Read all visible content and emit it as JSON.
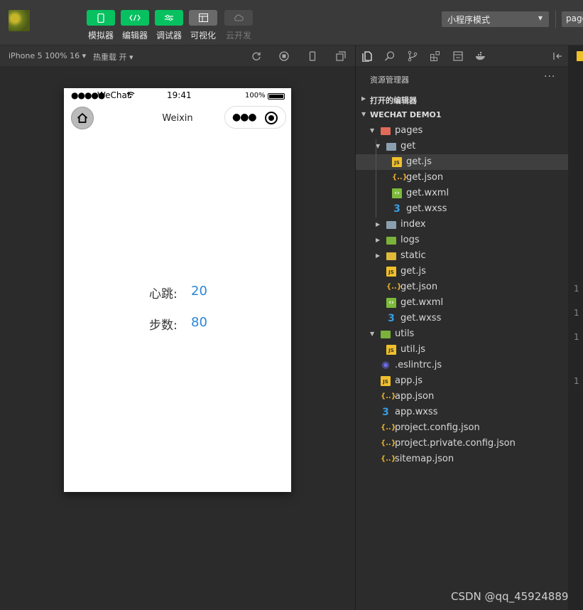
{
  "toolbar": {
    "tools": [
      {
        "label": "模拟器",
        "icon": "phone-icon"
      },
      {
        "label": "编辑器",
        "icon": "code-icon"
      },
      {
        "label": "调试器",
        "icon": "debug-icon"
      },
      {
        "label": "可视化",
        "icon": "layout-icon"
      },
      {
        "label": "云开发",
        "icon": "cloud-icon"
      }
    ],
    "mode": "小程序模式",
    "page_select": "page"
  },
  "simulator_bar": {
    "device": "iPhone 5 100% 16",
    "hot_reload": "热重载 开"
  },
  "phone": {
    "status": {
      "signal": "●●●●●",
      "carrier": "WeChat",
      "time": "19:41",
      "battery": "100%"
    },
    "nav_title": "Weixin",
    "rows": [
      {
        "label": "心跳:",
        "value": "20"
      },
      {
        "label": "步数:",
        "value": "80"
      }
    ]
  },
  "explorer": {
    "title": "资源管理器",
    "more": "···",
    "open_editors": "打开的编辑器",
    "project": "WECHAT DEMO1",
    "items": [
      {
        "name": "pages",
        "type": "folder-red",
        "indent": 0,
        "arrow": "▾"
      },
      {
        "name": "get",
        "type": "folder",
        "indent": 1,
        "arrow": "▾"
      },
      {
        "name": "get.js",
        "type": "js",
        "indent": 2,
        "selected": true
      },
      {
        "name": "get.json",
        "type": "json",
        "indent": 2
      },
      {
        "name": "get.wxml",
        "type": "wxml",
        "indent": 2
      },
      {
        "name": "get.wxss",
        "type": "wxss",
        "indent": 2
      },
      {
        "name": "index",
        "type": "folder",
        "indent": 1,
        "arrow": "▸"
      },
      {
        "name": "logs",
        "type": "folder-green",
        "indent": 1,
        "arrow": "▸"
      },
      {
        "name": "static",
        "type": "folder-yellow",
        "indent": 1,
        "arrow": "▸"
      },
      {
        "name": "get.js",
        "type": "js",
        "indent": 1
      },
      {
        "name": "get.json",
        "type": "json",
        "indent": 1
      },
      {
        "name": "get.wxml",
        "type": "wxml",
        "indent": 1
      },
      {
        "name": "get.wxss",
        "type": "wxss",
        "indent": 1
      },
      {
        "name": "utils",
        "type": "folder-green",
        "indent": 0,
        "arrow": "▾"
      },
      {
        "name": "util.js",
        "type": "js",
        "indent": 1
      },
      {
        "name": ".eslintrc.js",
        "type": "eslint",
        "indent": 0
      },
      {
        "name": "app.js",
        "type": "js",
        "indent": 0
      },
      {
        "name": "app.json",
        "type": "json",
        "indent": 0
      },
      {
        "name": "app.wxss",
        "type": "wxss",
        "indent": 0
      },
      {
        "name": "project.config.json",
        "type": "json",
        "indent": 0
      },
      {
        "name": "project.private.config.json",
        "type": "json",
        "indent": 0
      },
      {
        "name": "sitemap.json",
        "type": "json",
        "indent": 0
      }
    ]
  },
  "edge_numbers": [
    "1",
    "1",
    "1",
    "1"
  ],
  "watermark": "CSDN @qq_45924889"
}
